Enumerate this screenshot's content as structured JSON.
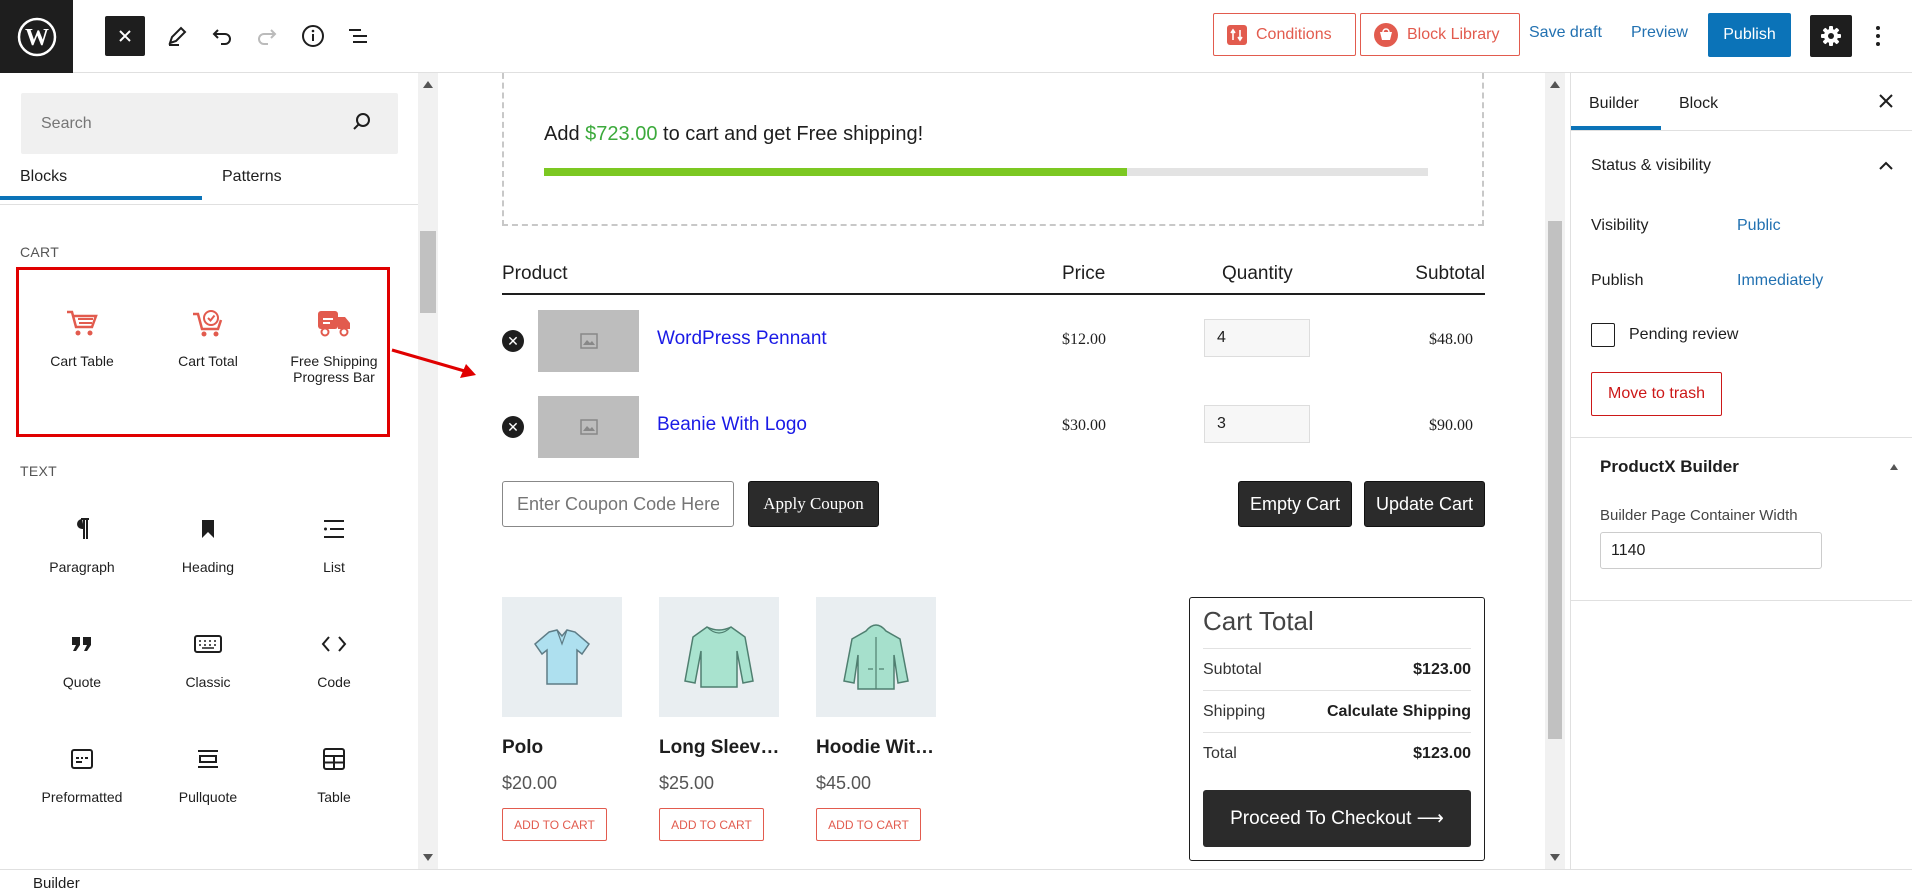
{
  "topbar": {
    "conditions_label": "Conditions",
    "block_library_label": "Block Library",
    "save_draft_label": "Save draft",
    "preview_label": "Preview",
    "publish_label": "Publish"
  },
  "inserter": {
    "search_placeholder": "Search",
    "tabs": [
      "Blocks",
      "Patterns"
    ],
    "categories": [
      {
        "label": "CART",
        "items": [
          "Cart Table",
          "Cart Total",
          "Free Shipping Progress Bar"
        ]
      },
      {
        "label": "TEXT",
        "items": [
          "Paragraph",
          "Heading",
          "List",
          "Quote",
          "Classic",
          "Code",
          "Preformatted",
          "Pullquote",
          "Table"
        ]
      }
    ]
  },
  "canvas": {
    "shipping": {
      "prefix": "Add ",
      "amount": "$723.00",
      "suffix": " to cart and get Free shipping!",
      "progress_fraction": 0.66
    },
    "table": {
      "headers": [
        "Product",
        "Price",
        "Quantity",
        "Subtotal"
      ],
      "rows": [
        {
          "name": "WordPress Pennant",
          "price": "$12.00",
          "qty": "4",
          "subtotal": "$48.00"
        },
        {
          "name": "Beanie With Logo",
          "price": "$30.00",
          "qty": "3",
          "subtotal": "$90.00"
        }
      ]
    },
    "coupon_placeholder": "Enter Coupon Code Here...",
    "apply_coupon_label": "Apply Coupon",
    "empty_cart_label": "Empty Cart",
    "update_cart_label": "Update Cart",
    "products": [
      {
        "title": "Polo",
        "price": "$20.00",
        "button": "ADD TO CART"
      },
      {
        "title": "Long Sleev…",
        "price": "$25.00",
        "button": "ADD TO CART"
      },
      {
        "title": "Hoodie Wit…",
        "price": "$45.00",
        "button": "ADD TO CART"
      }
    ],
    "cart_total": {
      "title": "Cart Total",
      "rows": [
        {
          "label": "Subtotal",
          "value": "$123.00"
        },
        {
          "label": "Shipping",
          "value": "Calculate Shipping"
        },
        {
          "label": "Total",
          "value": "$123.00"
        }
      ],
      "checkout_label": "Proceed To Checkout ⟶"
    }
  },
  "sidebar": {
    "tabs": [
      "Builder",
      "Block"
    ],
    "status_title": "Status & visibility",
    "visibility_label": "Visibility",
    "visibility_value": "Public",
    "publish_label": "Publish",
    "publish_value": "Immediately",
    "pending_label": "Pending review",
    "trash_label": "Move to trash",
    "productx_title": "ProductX Builder",
    "width_label": "Builder Page Container Width",
    "width_value": "1140"
  },
  "footer": {
    "breadcrumb": "Builder"
  },
  "colors": {
    "accent": "#0b73b8",
    "brand_orange": "#e25b4e",
    "progress_green": "#7cc822",
    "highlight_red": "#e00000"
  }
}
